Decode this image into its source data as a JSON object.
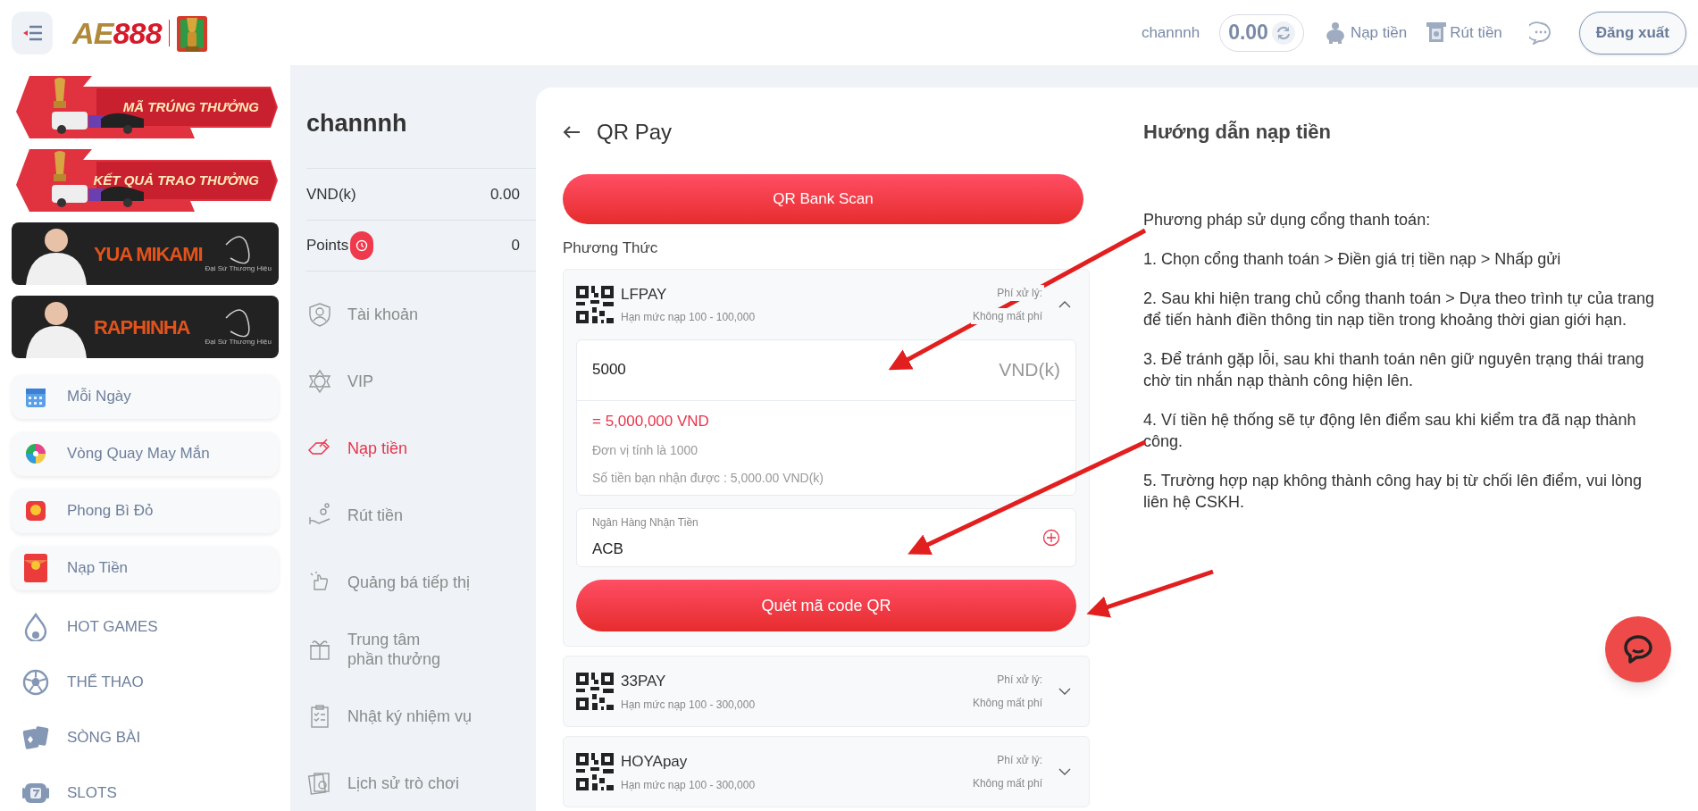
{
  "header": {
    "logo": [
      "AE",
      "888"
    ],
    "username": "channnh",
    "balance": "0.00",
    "deposit": "Nạp tiền",
    "withdraw": "Rút tiền",
    "logout": "Đăng xuất"
  },
  "sidebar": {
    "banners": [
      {
        "kind": "promo",
        "title": "MÃ TRÚNG THƯỞNG"
      },
      {
        "kind": "promo",
        "title": "KẾT QUẢ TRAO THƯỞNG"
      },
      {
        "kind": "ambassador",
        "title": "YUA MIKAMI",
        "caption": "Đại Sứ Thương Hiệu"
      },
      {
        "kind": "ambassador",
        "title": "RAPHINHA",
        "caption": "Đại Sứ Thương Hiệu"
      }
    ],
    "cards": [
      "Mỗi Ngày",
      "Vòng Quay May Mắn",
      "Phong Bì Đỏ",
      "Nạp Tiền"
    ],
    "games": [
      "HOT GAMES",
      "THỂ THAO",
      "SÒNG BÀI",
      "SLOTS"
    ]
  },
  "account_panel": {
    "username": "channnh",
    "balances": [
      {
        "label": "VND(k)",
        "value": "0.00"
      },
      {
        "label": "Points",
        "value": "0"
      }
    ],
    "menu": [
      {
        "label": "Tài khoản",
        "selected": false
      },
      {
        "label": "VIP",
        "selected": false
      },
      {
        "label": "Nạp tiền",
        "selected": true
      },
      {
        "label": "Rút tiền",
        "selected": false
      },
      {
        "label": "Quảng bá tiếp thị",
        "selected": false
      },
      {
        "label": "Trung tâm phần thưởng",
        "selected": false
      },
      {
        "label": "Nhật ký nhiệm vụ",
        "selected": false
      },
      {
        "label": "Lịch sử trò chơi",
        "selected": false
      }
    ]
  },
  "qr_pay": {
    "title": "QR Pay",
    "scan_button": "QR Bank Scan",
    "method_label": "Phương Thức",
    "methods": [
      {
        "name": "LFPAY",
        "limit": "Hạn mức nạp 100 - 100,000",
        "fee_label": "Phí xử lý:",
        "fee_value": "Không mất phí",
        "expanded": true
      },
      {
        "name": "33PAY",
        "limit": "Hạn mức nạp 100 - 300,000",
        "fee_label": "Phí xử lý:",
        "fee_value": "Không mất phí",
        "expanded": false
      },
      {
        "name": "HOYApay",
        "limit": "Hạn mức nạp 100 - 300,000",
        "fee_label": "Phí xử lý:",
        "fee_value": "Không mất phí",
        "expanded": false
      }
    ],
    "form": {
      "amount": "5000",
      "unit": "VND(k)",
      "converted": "= 5,000,000 VND",
      "note": "Đơn vị tính là 1000",
      "received": "Số tiền bạn nhận được : 5,000.00 VND(k)",
      "bank_label": "Ngân Hàng Nhận Tiền",
      "bank_value": "ACB",
      "submit": "Quét mã code QR"
    }
  },
  "guide": {
    "title": "Hướng dẫn nạp tiền",
    "intro": "Phương pháp sử dụng cổng thanh toán:",
    "steps": [
      "1. Chọn cổng thanh toán > Điền giá trị tiền nạp > Nhấp gửi",
      "2. Sau khi hiện trang chủ cổng thanh toán > Dựa theo trình tự của trang để tiến hành điền thông tin nạp tiền trong khoảng thời gian giới hạn.",
      "3. Để tránh gặp lỗi, sau khi thanh toán nên giữ nguyên trạng thái trang chờ tin nhắn nạp thành công hiện lên.",
      "4. Ví tiền hệ thống sẽ tự động lên điểm sau khi kiểm tra đã nạp thành công.",
      "5. Trường hợp nạp không thành công hay bị từ chối lên điểm, vui lòng liên hệ CSKH."
    ]
  }
}
